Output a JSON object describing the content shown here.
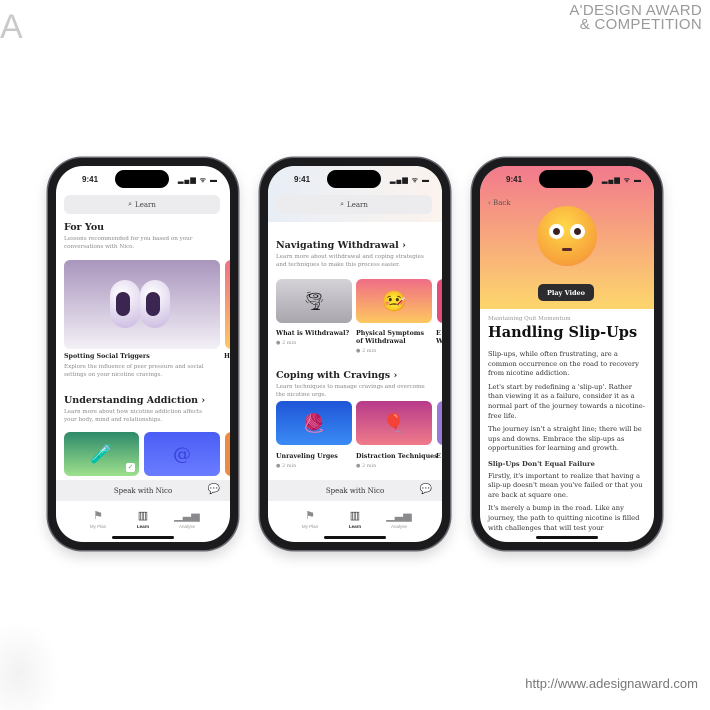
{
  "branding": {
    "logo_letter": "A",
    "award_line1": "A'DESIGN AWARD",
    "award_line2": "& COMPETITION",
    "url": "http://www.adesignaward.com"
  },
  "status": {
    "time": "9:41",
    "signal": "▂▄▆ ᯤ ▬"
  },
  "tabbar": {
    "items": [
      {
        "label": "My Plan",
        "icon": "flag-icon"
      },
      {
        "label": "Learn",
        "icon": "books-icon"
      },
      {
        "label": "Analyse",
        "icon": "bar-chart-icon"
      }
    ]
  },
  "speak": {
    "label": "Speak with Nico",
    "icon": "chat-bubbles-icon"
  },
  "phone1": {
    "search": "Learn",
    "for_you": {
      "title": "For You",
      "desc": "Lessons recommended for you based on your conversations with Nico.",
      "card": {
        "title": "Spotting Social Triggers",
        "desc": "Explore the influence of peer pressure and social settings on your nicotine cravings.",
        "peek_title": "H",
        "peek_desc": "L"
      }
    },
    "understanding": {
      "title": "Understanding Addiction",
      "chevron": "›",
      "desc": "Learn more about how nicotine addiction affects your body, mind and relationships."
    }
  },
  "phone2": {
    "search": "Learn",
    "withdrawal": {
      "title": "Navigating Withdrawal",
      "chevron": "›",
      "desc": "Learn more about withdrawal and coping strategies and techniques to make this process easier.",
      "cards": [
        {
          "title": "What is Withdrawal?",
          "duration": "2 min"
        },
        {
          "title": "Physical Symptoms of Withdrawal",
          "duration": "2 min"
        },
        {
          "title": "E W",
          "duration": ""
        }
      ]
    },
    "cravings": {
      "title": "Coping with Cravings",
      "chevron": "›",
      "desc": "Learn techniques to manage cravings and overcome the nicotine urge.",
      "cards": [
        {
          "title": "Unraveling Urges",
          "duration": "2 min"
        },
        {
          "title": "Distraction Techniques",
          "duration": "2 min"
        },
        {
          "title": "E",
          "duration": ""
        }
      ]
    }
  },
  "phone3": {
    "back": "Back",
    "play_video": "Play Video",
    "kicker": "Maintaining Quit Momentum",
    "title": "Handling Slip-Ups",
    "paragraphs": [
      "Slip-ups, while often frustrating, are a common occurrence on the road to recovery from nicotine addiction.",
      "Let's start by redefining a 'slip-up'. Rather than viewing it as a failure, consider it as a normal part of the journey towards a nicotine-free life.",
      "The journey isn't a straight line; there will be ups and downs. Embrace the slip-ups as opportunities for learning and growth."
    ],
    "subheading": "Slip-Ups Don't Equal Failure",
    "paragraphs2": [
      "Firstly, it's important to realize that having a slip-up doesn't mean you've failed or that you are back at square one.",
      "It's merely a bump in the road. Like any journey, the path to quitting nicotine is filled with challenges that will test your"
    ]
  },
  "colors": {
    "header_top": "#f2798d",
    "header_bottom": "#fdd66c",
    "speak_bg": "#efeff2"
  }
}
